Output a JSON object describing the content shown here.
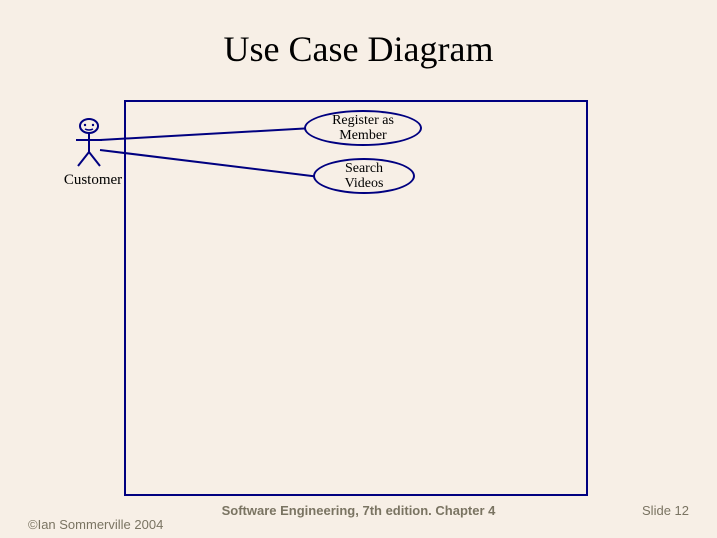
{
  "title": "Use Case Diagram",
  "actor": {
    "name": "Customer"
  },
  "usecases": {
    "register": "Register as\nMember",
    "search": "Search\nVideos"
  },
  "footer": {
    "copyright": "©Ian Sommerville 2004",
    "center": "Software Engineering, 7th edition. Chapter 4",
    "slide": "Slide  12"
  },
  "chart_data": {
    "type": "diagram",
    "diagram_type": "uml-use-case",
    "actors": [
      {
        "id": "customer",
        "label": "Customer"
      }
    ],
    "use_cases": [
      {
        "id": "register",
        "label": "Register as Member"
      },
      {
        "id": "search",
        "label": "Search Videos"
      }
    ],
    "associations": [
      {
        "actor": "customer",
        "use_case": "register"
      },
      {
        "actor": "customer",
        "use_case": "search"
      }
    ],
    "system_boundary": true
  }
}
